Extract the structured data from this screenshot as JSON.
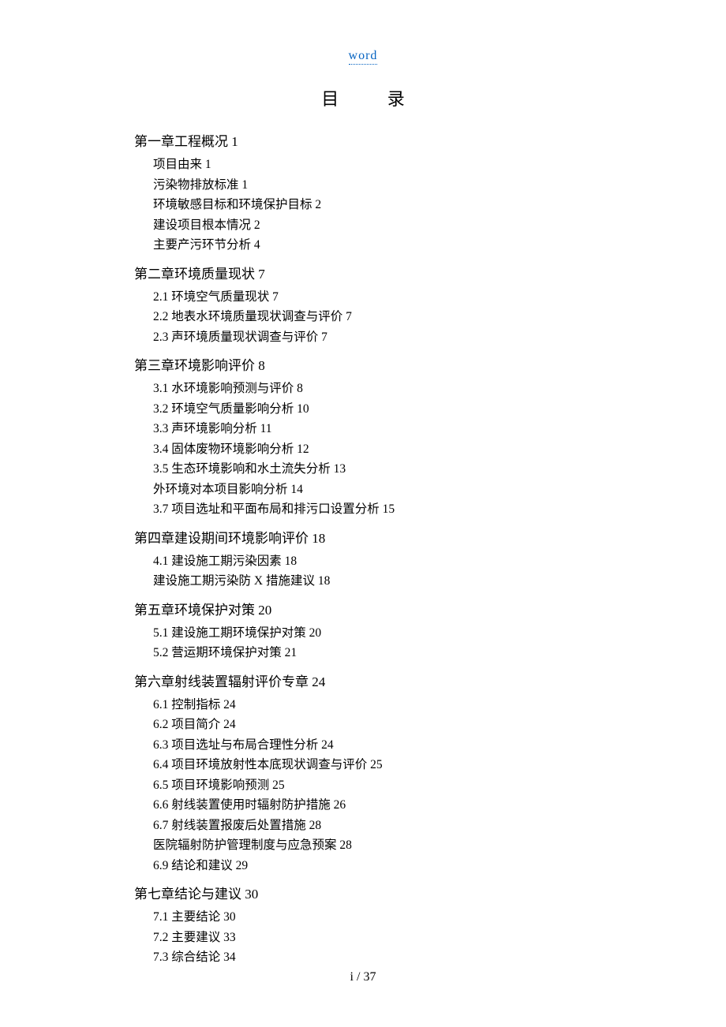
{
  "header": {
    "link_text": "word"
  },
  "title": "目 录",
  "toc": [
    {
      "heading": "第一章工程概况 1",
      "items": [
        "项目由来 1",
        "污染物排放标准 1",
        "环境敏感目标和环境保护目标 2",
        "建设项目根本情况 2",
        "主要产污环节分析 4"
      ]
    },
    {
      "heading": "第二章环境质量现状 7",
      "items": [
        "2.1 环境空气质量现状 7",
        "2.2 地表水环境质量现状调查与评价 7",
        "2.3 声环境质量现状调查与评价 7"
      ]
    },
    {
      "heading": "第三章环境影响评价 8",
      "items": [
        "3.1 水环境影响预测与评价 8",
        "3.2 环境空气质量影响分析 10",
        "3.3 声环境影响分析 11",
        "3.4 固体废物环境影响分析 12",
        "3.5 生态环境影响和水土流失分析 13",
        "外环境对本项目影响分析 14",
        "3.7 项目选址和平面布局和排污口设置分析 15"
      ]
    },
    {
      "heading": "第四章建设期间环境影响评价 18",
      "items": [
        "4.1 建设施工期污染因素 18",
        "建设施工期污染防 X 措施建议 18"
      ]
    },
    {
      "heading": "第五章环境保护对策 20",
      "items": [
        "5.1 建设施工期环境保护对策 20",
        "5.2 营运期环境保护对策 21"
      ]
    },
    {
      "heading": "第六章射线装置辐射评价专章 24",
      "items": [
        "6.1 控制指标 24",
        "6.2 项目简介 24",
        "6.3 项目选址与布局合理性分析 24",
        "6.4 项目环境放射性本底现状调查与评价 25",
        "6.5 项目环境影响预测 25",
        "6.6 射线装置使用时辐射防护措施 26",
        "6.7 射线装置报废后处置措施 28",
        "医院辐射防护管理制度与应急预案 28",
        "6.9 结论和建议 29"
      ]
    },
    {
      "heading": "第七章结论与建议 30",
      "items": [
        "7.1 主要结论 30",
        "7.2 主要建议 33",
        "7.3 综合结论 34"
      ]
    }
  ],
  "footer": {
    "page_label": "i / 37"
  }
}
